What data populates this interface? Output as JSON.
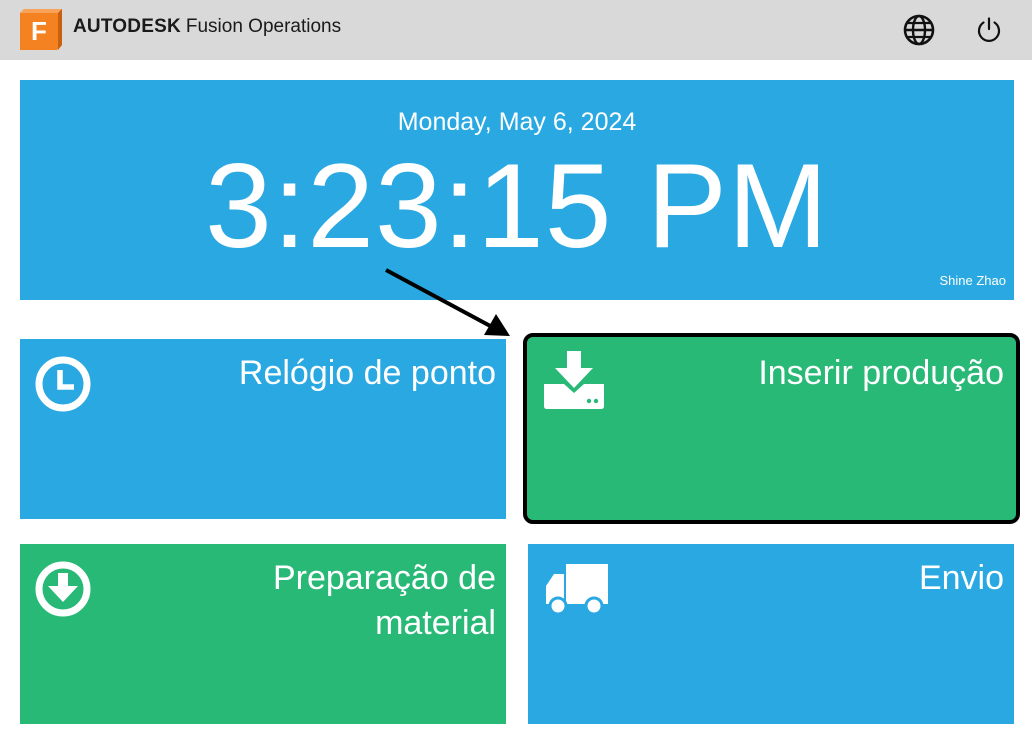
{
  "header": {
    "logo_letter": "F",
    "brand_strong": "AUTODESK",
    "brand_light": "Fusion Operations",
    "language_icon": "globe-icon",
    "logout_icon": "power-icon"
  },
  "clock": {
    "date": "Monday, May 6, 2024",
    "time": "3:23:15 PM",
    "user": "Shine Zhao"
  },
  "tiles": [
    {
      "label": "Relógio de ponto",
      "icon": "clock-icon",
      "color": "#29a8e2"
    },
    {
      "label": "Inserir produção",
      "icon": "download-tray-icon",
      "color": "#29b977",
      "selected": true
    },
    {
      "label": "Preparação de\nmaterial",
      "icon": "arrow-down-circle-icon",
      "color": "#29b977"
    },
    {
      "label": "Envio",
      "icon": "truck-icon",
      "color": "#29a8e2"
    }
  ],
  "colors": {
    "header_bg": "#d9d9d9",
    "blue": "#29a8e2",
    "green": "#29b977",
    "logo_orange": "#f58220"
  }
}
